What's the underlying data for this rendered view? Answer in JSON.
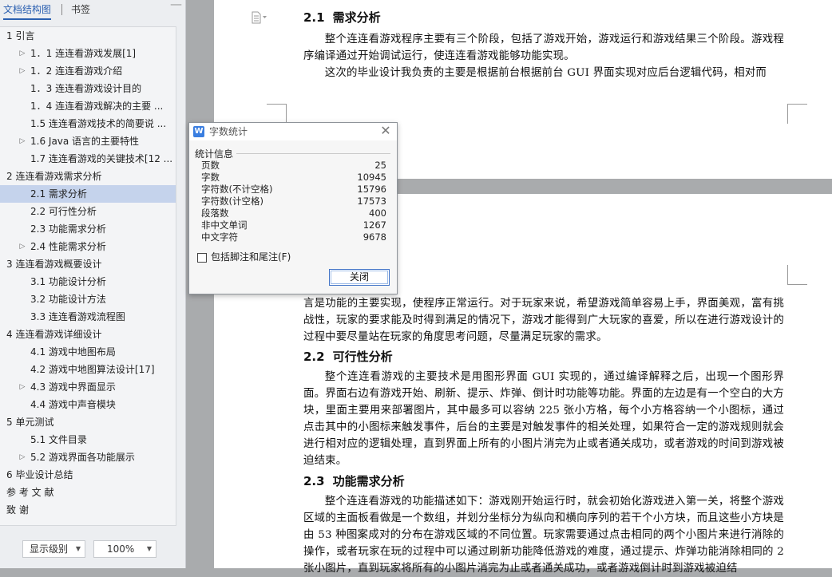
{
  "nav": {
    "tabs": [
      "文档结构图",
      "书签"
    ],
    "close_glyph": "—",
    "items": [
      {
        "label": "1   引言",
        "level": 1,
        "arrow": ""
      },
      {
        "label": "1．1  连连看游戏发展[1]",
        "level": 2,
        "arrow": "▷"
      },
      {
        "label": "1．2  连连看游戏介绍",
        "level": 2,
        "arrow": "▷"
      },
      {
        "label": "1．3  连连看游戏设计目的",
        "level": 2,
        "arrow": ""
      },
      {
        "label": "1．4  连连看游戏解决的主要 ...",
        "level": 2,
        "arrow": ""
      },
      {
        "label": "1.5  连连看游戏技术的简要说 ...",
        "level": 2,
        "arrow": ""
      },
      {
        "label": "1.6 Java 语言的主要特性",
        "level": 2,
        "arrow": "▷"
      },
      {
        "label": "1.7  连连看游戏的关键技术[12 ...",
        "level": 2,
        "arrow": ""
      },
      {
        "label": "2   连连看游戏需求分析",
        "level": 1,
        "arrow": ""
      },
      {
        "label": "2.1  需求分析",
        "level": 2,
        "arrow": "",
        "selected": true
      },
      {
        "label": "2.2  可行性分析",
        "level": 2,
        "arrow": ""
      },
      {
        "label": "2.3  功能需求分析",
        "level": 2,
        "arrow": ""
      },
      {
        "label": "2.4  性能需求分析",
        "level": 2,
        "arrow": "▷"
      },
      {
        "label": "3   连连看游戏概要设计",
        "level": 1,
        "arrow": ""
      },
      {
        "label": "3.1  功能设计分析",
        "level": 2,
        "arrow": ""
      },
      {
        "label": "3.2  功能设计方法",
        "level": 2,
        "arrow": ""
      },
      {
        "label": "3.3  连连看游戏流程图",
        "level": 2,
        "arrow": ""
      },
      {
        "label": "4  连连看游戏详细设计",
        "level": 1,
        "arrow": ""
      },
      {
        "label": "4.1  游戏中地图布局",
        "level": 2,
        "arrow": ""
      },
      {
        "label": "4.2  游戏中地图算法设计[17]",
        "level": 2,
        "arrow": ""
      },
      {
        "label": "4.3  游戏中界面显示",
        "level": 2,
        "arrow": "▷"
      },
      {
        "label": "4.4  游戏中声音模块",
        "level": 2,
        "arrow": ""
      },
      {
        "label": "5  单元测试",
        "level": 1,
        "arrow": ""
      },
      {
        "label": "5.1  文件目录",
        "level": 2,
        "arrow": ""
      },
      {
        "label": "5.2  游戏界面各功能展示",
        "level": 2,
        "arrow": "▷"
      },
      {
        "label": "6    毕业设计总结",
        "level": 1,
        "arrow": ""
      },
      {
        "label": "参 考 文 献",
        "level": 1,
        "arrow": ""
      },
      {
        "label": "致    谢",
        "level": 1,
        "arrow": ""
      }
    ],
    "level_dropdown": "显示级别",
    "zoom_dropdown": "100%"
  },
  "document": {
    "page1": {
      "heading_num": "2.1",
      "heading_text": "需求分析",
      "para1": "整个连连看游戏程序主要有三个阶段，包括了游戏开始，游戏运行和游戏结果三个阶段。游戏程序编译通过开始调试运行，使连连看游戏能够功能实现。",
      "para2": "这次的毕业设计我负责的主要是根据前台根据前台 GUI 界面实现对应后台逻辑代码，相对而"
    },
    "page2": {
      "para_cont": "言是功能的主要实现，使程序正常运行。对于玩家来说，希望游戏简单容易上手，界面美观，富有挑战性，玩家的要求能及时得到满足的情况下，游戏才能得到广大玩家的喜爱，所以在进行游戏设计的过程中要尽量站在玩家的角度思考问题，尽量满足玩家的需求。",
      "h22_num": "2.2",
      "h22_text": "可行性分析",
      "para22": "整个连连看游戏的主要技术是用图形界面 GUI 实现的，通过编译解释之后，出现一个图形界面。界面右边有游戏开始、刷新、提示、炸弹、倒计时功能等功能。界面的左边是有一个空白的大方块，里面主要用来部署图片，其中最多可以容纳 225 张小方格，每个小方格容纳一个小图标，通过点击其中的小图标来触发事件，后台的主要是对触发事件的相关处理，如果符合一定的游戏规则就会进行相对应的逻辑处理，直到界面上所有的小图片消完为止或者通关成功，或者游戏的时间到游戏被迫结束。",
      "h23_num": "2.3",
      "h23_text": "功能需求分析",
      "para23": "整个连连看游戏的功能描述如下：游戏刚开始运行时，就会初始化游戏进入第一关，将整个游戏区域的主面板看做是一个数组，并划分坐标分为纵向和横向序列的若干个小方块，而且这些小方块是由 53 种图案成对的分布在游戏区域的不同位置。玩家需要通过点击相同的两个小图片来进行消除的操作，或者玩家在玩的过程中可以通过刷新功能降低游戏的难度，通过提示、炸弹功能消除相同的 2 张小图片，直到玩家将所有的小图片消完为止或者通关成功，或者游戏倒计时到游戏被迫结"
    }
  },
  "dialog": {
    "title": "字数统计",
    "logo": "W",
    "group_label": "统计信息",
    "stats": [
      {
        "key": "页数",
        "value": "25"
      },
      {
        "key": "字数",
        "value": "10945"
      },
      {
        "key": "字符数(不计空格)",
        "value": "15796"
      },
      {
        "key": "字符数(计空格)",
        "value": "17573"
      },
      {
        "key": "段落数",
        "value": "400"
      },
      {
        "key": "非中文单词",
        "value": "1267"
      },
      {
        "key": "中文字符",
        "value": "9678"
      }
    ],
    "checkbox_label": "包括脚注和尾注(F)",
    "close_button": "关闭"
  }
}
